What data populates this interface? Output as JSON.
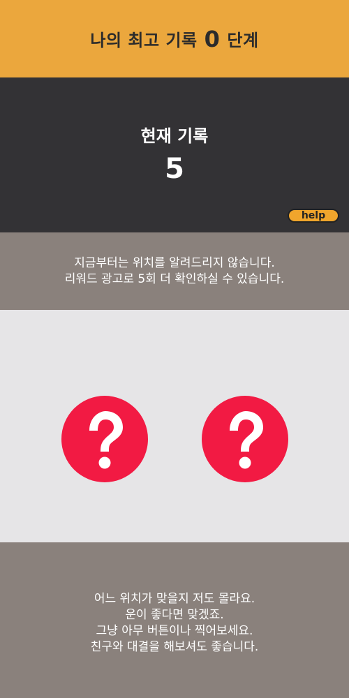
{
  "top_bar": {
    "prefix": "나의 최고 기록",
    "best_record": "0",
    "suffix": "단계"
  },
  "record_panel": {
    "title": "현재 기록",
    "value": "5",
    "help_label": "help"
  },
  "notice": {
    "lines": [
      "지금부터는 위치를 알려드리지 않습니다.",
      "리워드 광고로 5회 더 확인하실 수 있습니다."
    ]
  },
  "choices": {
    "icon": "question-mark-icon",
    "color": "#F21A43",
    "count": 2
  },
  "bottom_message": {
    "lines": [
      "어느 위치가 맞을지 저도 몰라요.",
      "운이 좋다면 맞겠죠.",
      "그냥 아무 버튼이나 찍어보세요.",
      "친구와 대결을 해보셔도 좋습니다."
    ]
  },
  "colors": {
    "top_bar": "#EBA73D",
    "record_panel": "#333235",
    "notice_panel": "#8A817C",
    "choice_area": "#E6E5E7",
    "help_button": "#F0A52C"
  }
}
